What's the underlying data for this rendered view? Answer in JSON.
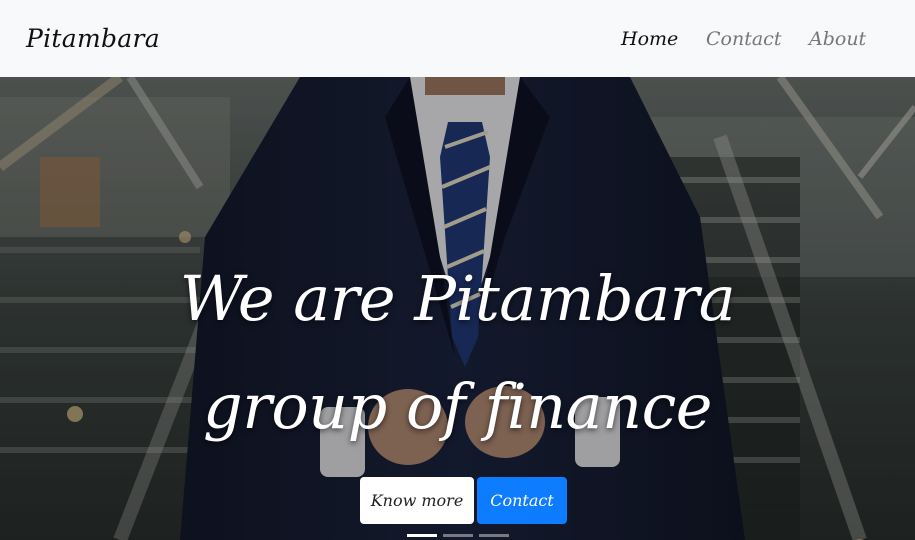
{
  "navbar": {
    "brand": "Pitambara",
    "links": [
      "Home",
      "Contact",
      "About"
    ],
    "active": "Home"
  },
  "hero": {
    "headline_line1": "We are Pitambara",
    "headline_line2": "group of finance",
    "button_primary": "Know more",
    "button_secondary": "Contact",
    "slides": 3,
    "active_slide": 1
  },
  "colors": {
    "navbar_bg": "#f8f9fa",
    "primary": "#0d7cff"
  }
}
